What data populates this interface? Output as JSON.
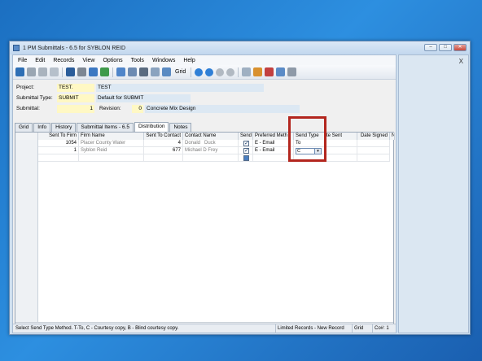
{
  "window": {
    "title": "1 PM Submittals - 6.5 for SYBLON REID"
  },
  "menu": [
    "File",
    "Edit",
    "Records",
    "View",
    "Options",
    "Tools",
    "Windows",
    "Help"
  ],
  "toolbar": {
    "grid_label": "Grid"
  },
  "fields": {
    "project_label": "Project:",
    "project_code": "TEST.",
    "project_name": "TEST",
    "type_label": "Submittal Type:",
    "type_code": "SUBMIT",
    "type_name": "Default for SUBMIT",
    "submittal_label": "Submittal:",
    "submittal_no": "1",
    "revision_label": "Revision:",
    "revision_no": "0",
    "submittal_desc": "Concrete Mix Design"
  },
  "tabs": [
    "Grid",
    "Info",
    "History",
    "Submittal Items - 6.5",
    "Distribution",
    "Notes"
  ],
  "active_tab": "Distribution",
  "grid": {
    "columns": [
      "Sent To Firm",
      "Firm Name",
      "Sent To Contact",
      "Contact Name",
      "Send",
      "Preferred Meth",
      "Send Type",
      "te Sent",
      "Date Signed",
      "N"
    ],
    "rows": [
      {
        "firm": "1054",
        "firm_name": "Placer County Water",
        "contact": "4",
        "contact_name": "Donald   Duck",
        "send": true,
        "method": "E - Email",
        "send_type": "To"
      },
      {
        "firm": "1",
        "firm_name": "Syblon Reid",
        "contact": "677",
        "contact_name": "Michael D Frey",
        "send": true,
        "method": "E - Email",
        "send_type": "C"
      },
      {
        "firm": "",
        "firm_name": "",
        "contact": "",
        "contact_name": "",
        "send": false,
        "method": "",
        "send_type": ""
      }
    ],
    "dropdown_arrow": "▾"
  },
  "status": {
    "message": "Select Send Type Method. T-To, C - Courtesy copy, B - Blind courtesy copy.",
    "records": "Limited Records - New Record",
    "mode": "Grid",
    "company": "Co#: 1"
  },
  "right_pane": {
    "close": "X"
  }
}
